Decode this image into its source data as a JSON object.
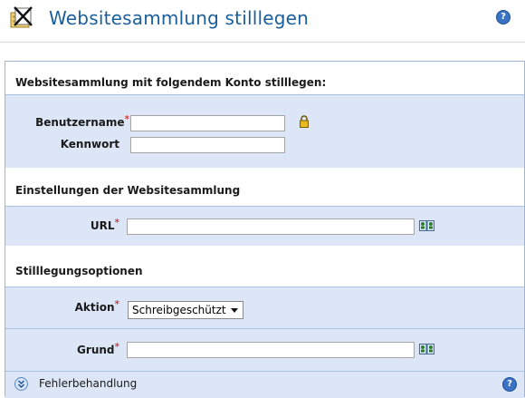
{
  "page": {
    "title": "Websitesammlung stilllegen"
  },
  "sections": {
    "account": {
      "heading": "Websitesammlung mit folgendem Konto stilllegen:",
      "username_label": "Benutzername",
      "password_label": "Kennwort",
      "username_value": "",
      "password_value": ""
    },
    "settings": {
      "heading": "Einstellungen der Websitesammlung",
      "url_label": "URL",
      "url_value": ""
    },
    "options": {
      "heading": "Stilllegungsoptionen",
      "action_label": "Aktion",
      "action_selected": "Schreibgeschützt",
      "reason_label": "Grund",
      "reason_value": ""
    }
  },
  "footer": {
    "label": "Fehlerbehandlung"
  },
  "required_marker": "*",
  "help_glyph": "?",
  "icons": [
    "retire-site-icon",
    "help-icon",
    "lock-icon",
    "address-book-icon",
    "expand-chevron-icon"
  ],
  "colors": {
    "title": "#1a5f9c",
    "section_band": "#dce6f6",
    "required": "#cc0000"
  }
}
